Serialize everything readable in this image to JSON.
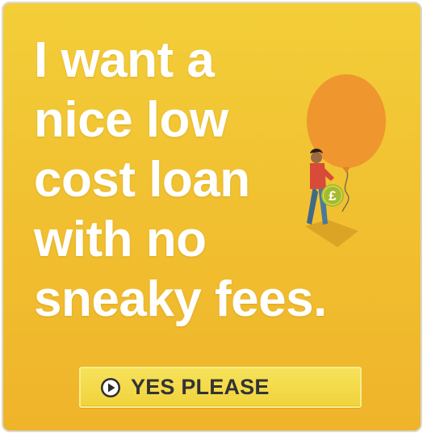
{
  "headline": {
    "lines": [
      "I want a",
      "nice low",
      "cost loan",
      "with no",
      "sneaky fees."
    ]
  },
  "illustration": {
    "icon": "balloon-person-icon",
    "coin_symbol": "£"
  },
  "cta": {
    "label": "YES PLEASE",
    "icon": "play-icon"
  },
  "colors": {
    "background_top": "#f3ce39",
    "background_bottom": "#f0b42a",
    "balloon": "#f0962e",
    "coin": "#a6ba2d",
    "button": "#f1d23c"
  }
}
